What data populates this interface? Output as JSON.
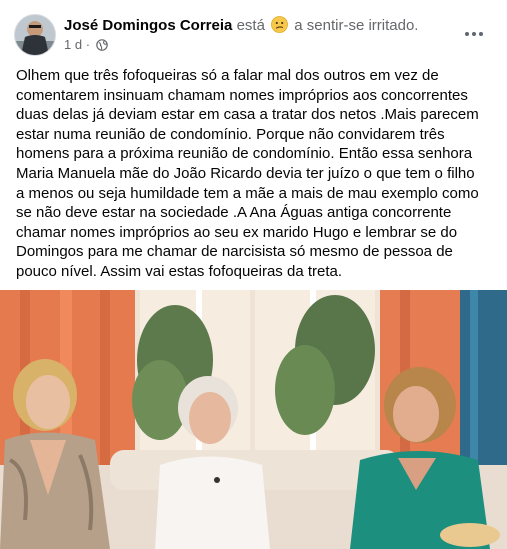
{
  "post": {
    "author": "José Domingos Correia",
    "feeling_prefix": "está",
    "feeling_emoji": "confused-face-icon",
    "feeling_text": "a sentir-se irritado.",
    "timestamp": "1 d",
    "separator": "·",
    "audience_icon": "globe-icon",
    "more_icon": "more-options-icon",
    "text": "Olhem que três fofoqueiras só a falar mal dos outros em vez de\ncomentarem insinuam chamam nomes impróprios aos concorrentes\nduas delas já deviam estar em casa a tratar dos netos .Mais parecem\nestar numa reunião de condomínio. Porque não convidarem três\nhomens para a próxima reunião de condomínio. Então essa senhora\nMaria Manuela mãe do João Ricardo devia ter juízo o que tem o filho\na menos ou seja humildade tem a mãe a mais de mau exemplo como\nse não deve estar na sociedade .A Ana Águas antiga concorrente\nchamar nomes impróprios ao seu ex marido Hugo e lembrar se do\nDomingos para me chamar de narcisista só mesmo de pessoa de\npouco nível. Assim vai estas fofoqueiras da treta."
  },
  "colors": {
    "text": "#050505",
    "secondary": "#65676b",
    "curtain": "#e8784a",
    "wall": "#f1e4d6",
    "sofa": "#e9ded2",
    "teal_dress": "#1c8f7f"
  }
}
